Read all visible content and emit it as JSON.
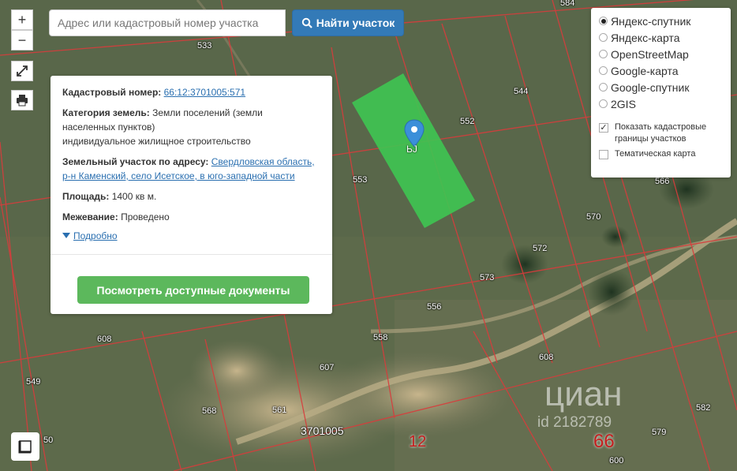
{
  "search": {
    "placeholder": "Адрес или кадастровый номер участка",
    "button_label": "Найти участок"
  },
  "map_controls": {
    "zoom_in": "+",
    "zoom_out": "−"
  },
  "info": {
    "cadastral_label": "Кадастровый номер:",
    "cadastral_value": "66:12:3701005:571",
    "category_label": "Категория земель:",
    "category_value_line1": "Земли поселений (земли",
    "category_value_line2": "населенных пунктов)",
    "category_value_line3": "индивидуальное жилищное строительство",
    "address_label": "Земельный участок по адресу:",
    "address_value": "Свердловская область, р-н Каменский, село Исетское, в юго-западной части",
    "area_label": "Площадь:",
    "area_value": "1400 кв м.",
    "survey_label": "Межевание:",
    "survey_value": "Проведено",
    "details_label": "Подробно",
    "docs_button": "Посмотреть доступные документы"
  },
  "layers": {
    "options": [
      {
        "label": "Яндекс-спутник",
        "selected": true
      },
      {
        "label": "Яндекс-карта",
        "selected": false
      },
      {
        "label": "OpenStreetMap",
        "selected": false
      },
      {
        "label": "Google-карта",
        "selected": false
      },
      {
        "label": "Google-спутник",
        "selected": false
      },
      {
        "label": "2GIS",
        "selected": false
      }
    ],
    "show_borders_label": "Показать кадастровые границы участков",
    "show_borders_checked": true,
    "thematic_label": "Тематическая карта",
    "thematic_checked": false
  },
  "map_labels": {
    "parcels": [
      "533",
      "584",
      "544",
      "552",
      "553",
      "570",
      "572",
      "573",
      "556",
      "558",
      "607",
      "608",
      "608",
      "561",
      "568",
      "579",
      "582",
      "600",
      "549",
      "50",
      "566"
    ],
    "block": "3701005",
    "big_12": "12",
    "big_66": "66",
    "pin_text": "ЬJ"
  },
  "watermark": {
    "brand": "циан",
    "id": "id 2182789"
  },
  "colors": {
    "selected_parcel": "#3ec552",
    "boundary": "#d83c3c",
    "primary": "#337ab7",
    "success": "#5cb85c"
  }
}
